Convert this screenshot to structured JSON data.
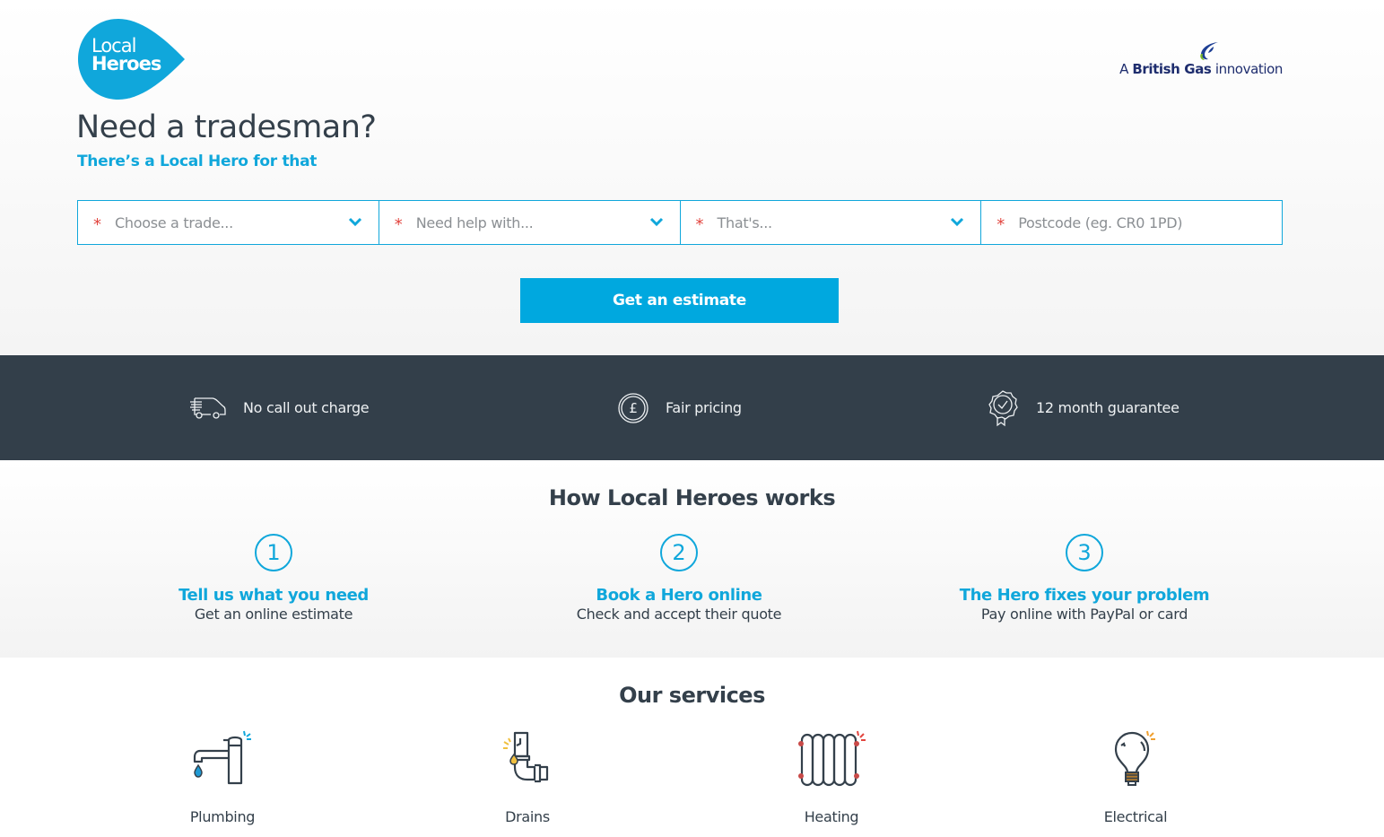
{
  "brand": {
    "logo_line1": "Local",
    "logo_line2": "Heroes",
    "logo_color": "#10a7db",
    "partner_prefix": "A",
    "partner_name": "British Gas",
    "partner_suffix": "innovation"
  },
  "hero": {
    "title": "Need a tradesman?",
    "subtitle": "There’s a Local Hero for that"
  },
  "form": {
    "required_marker": "*",
    "fields": [
      {
        "placeholder": "Choose a trade...",
        "type": "select"
      },
      {
        "placeholder": "Need help with...",
        "type": "select"
      },
      {
        "placeholder": "That's...",
        "type": "select"
      },
      {
        "placeholder": "Postcode (eg. CR0 1PD)",
        "type": "text"
      }
    ],
    "submit_label": "Get an estimate"
  },
  "usp": [
    {
      "icon": "van-icon",
      "label": "No call out charge"
    },
    {
      "icon": "pound-coin-icon",
      "label": "Fair pricing"
    },
    {
      "icon": "rosette-check-icon",
      "label": "12 month guarantee"
    }
  ],
  "how": {
    "heading": "How Local Heroes works",
    "steps": [
      {
        "number": "1",
        "title": "Tell us what you need",
        "description": "Get an online estimate"
      },
      {
        "number": "2",
        "title": "Book a Hero online",
        "description": "Check and accept their quote"
      },
      {
        "number": "3",
        "title": "The Hero fixes your problem",
        "description": "Pay online with PayPal or card"
      }
    ]
  },
  "services": {
    "heading": "Our services",
    "items": [
      {
        "icon": "tap-icon",
        "label": "Plumbing"
      },
      {
        "icon": "pipe-icon",
        "label": "Drains"
      },
      {
        "icon": "radiator-icon",
        "label": "Heating"
      },
      {
        "icon": "lightbulb-icon",
        "label": "Electrical"
      }
    ]
  },
  "colors": {
    "accent": "#10a7db",
    "cta": "#00a8df",
    "dark_band": "#333f4a",
    "required": "#e2453f",
    "text": "#34404b"
  }
}
